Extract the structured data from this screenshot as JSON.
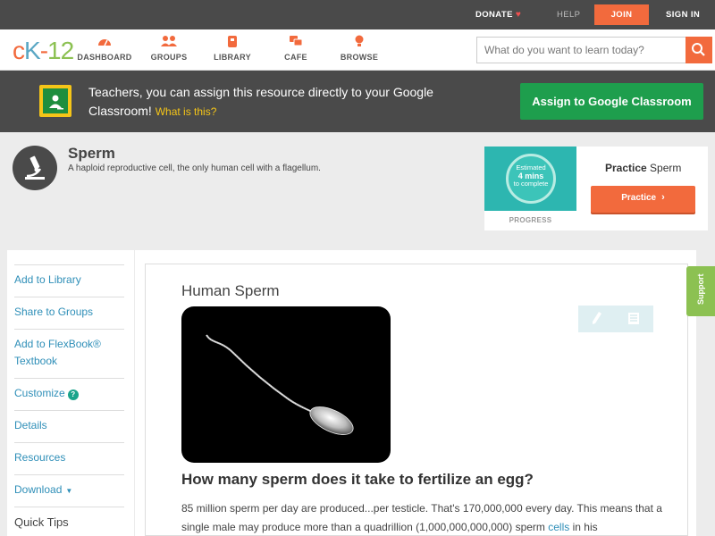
{
  "topbar": {
    "donate": "DONATE",
    "help": "HELP",
    "join": "JOIN",
    "signin": "SIGN IN"
  },
  "nav": {
    "logo": {
      "c": "c",
      "k": "K",
      "dash": "-",
      "num": "12"
    },
    "items": [
      {
        "label": "DASHBOARD",
        "icon": "dashboard-icon"
      },
      {
        "label": "GROUPS",
        "icon": "groups-icon"
      },
      {
        "label": "LIBRARY",
        "icon": "library-icon"
      },
      {
        "label": "CAFE",
        "icon": "cafe-icon"
      },
      {
        "label": "BROWSE",
        "icon": "browse-icon"
      }
    ],
    "search_placeholder": "What do you want to learn today?"
  },
  "banner": {
    "text": "Teachers, you can assign this resource directly to your Google Classroom!",
    "what_link": "What is this?",
    "assign_button": "Assign to Google Classroom"
  },
  "concept": {
    "title": "Sperm",
    "description": "A haploid reproductive cell, the only human cell with a flagellum."
  },
  "practice": {
    "est_line1": "Estimated",
    "est_line2": "4 mins",
    "est_line3": "to complete",
    "progress_label": "PROGRESS",
    "title_bold": "Practice",
    "title_rest": "Sperm",
    "button": "Practice"
  },
  "sidebar": {
    "items": [
      "Add to Library",
      "Share to Groups",
      "Add to FlexBook® Textbook",
      "Customize",
      "Details",
      "Resources",
      "Download",
      "Quick Tips"
    ]
  },
  "content": {
    "title": "Human Sperm",
    "question": "How many sperm does it take to fertilize an egg?",
    "para_a": "85 million sperm per day are produced...per testicle. That's 170,000,000 every day. This means that a single male may produce more than a quadrillion (1,000,000,000,000) sperm",
    "para_link": "cells",
    "para_b": "in his"
  },
  "support": "Support",
  "colors": {
    "accent": "#f26a3d",
    "link": "#2f8fb8",
    "google_green": "#1e9e4d",
    "support_green": "#8cc152"
  }
}
